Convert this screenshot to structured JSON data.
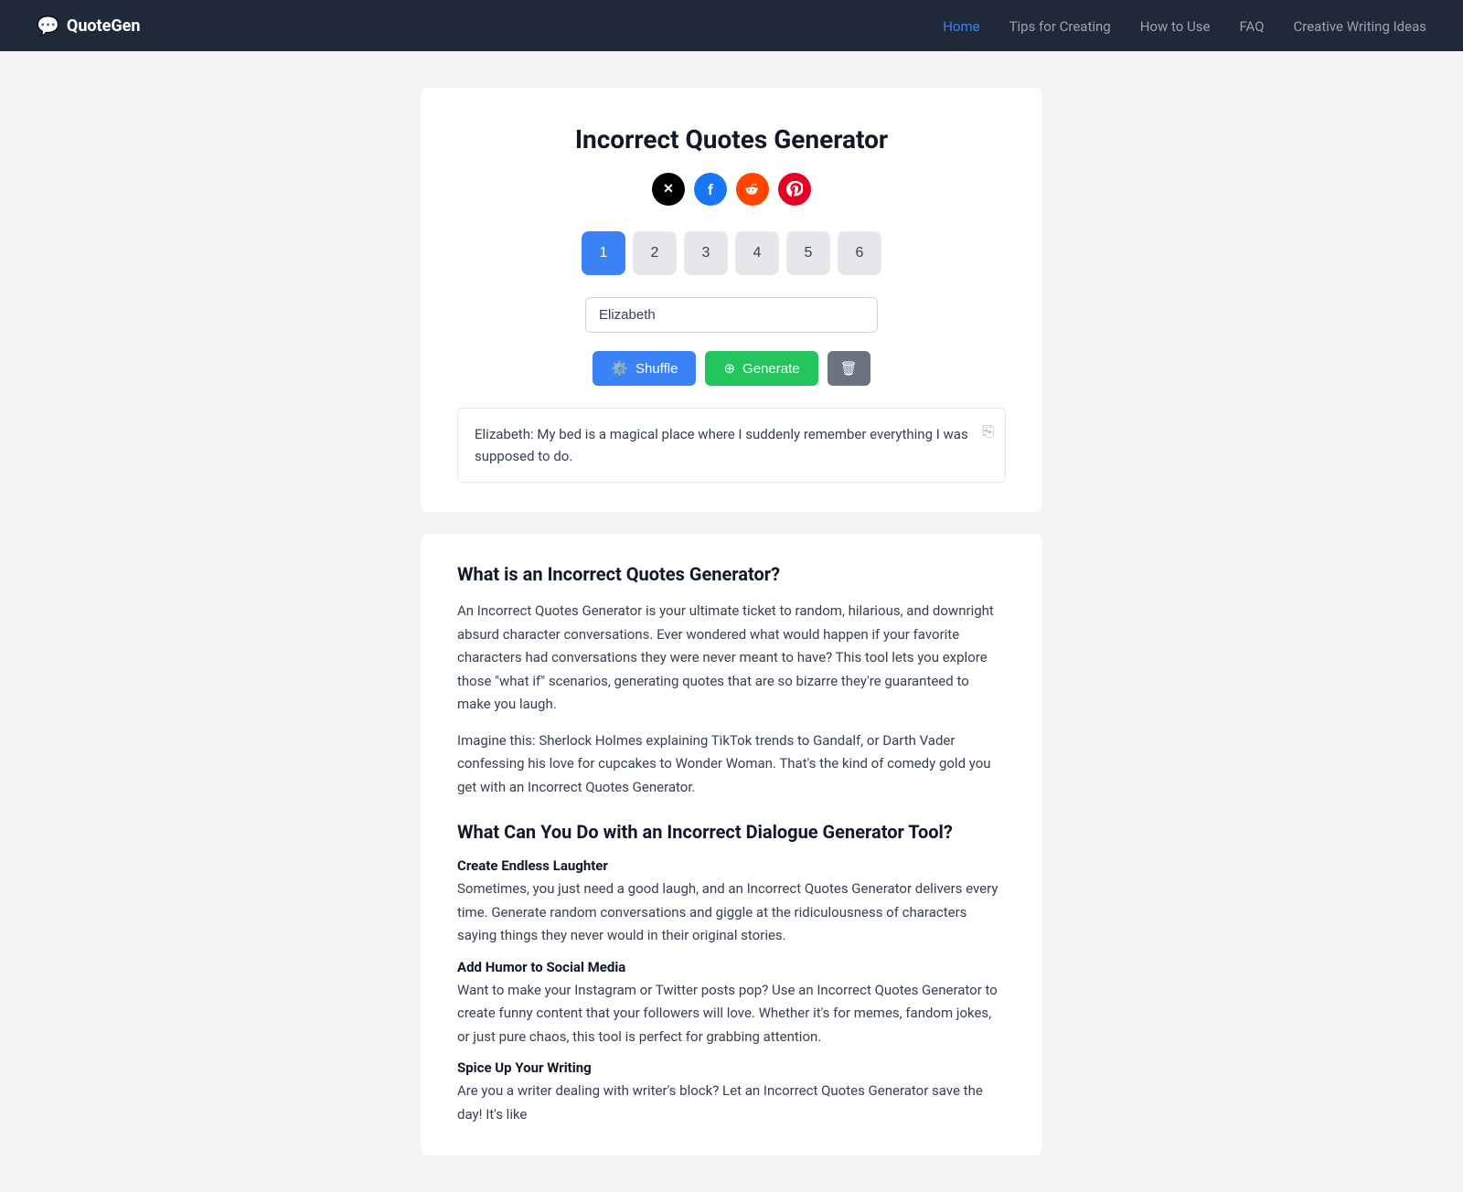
{
  "brand": {
    "name": "QuoteGen",
    "icon": "💬"
  },
  "nav": {
    "links": [
      {
        "label": "Home",
        "active": true
      },
      {
        "label": "Tips for Creating",
        "active": false
      },
      {
        "label": "How to Use",
        "active": false
      },
      {
        "label": "FAQ",
        "active": false
      },
      {
        "label": "Creative Writing Ideas",
        "active": false
      }
    ]
  },
  "generator": {
    "title": "Incorrect Quotes Generator",
    "social_icons": [
      {
        "name": "twitter",
        "symbol": "✕"
      },
      {
        "name": "facebook",
        "symbol": "f"
      },
      {
        "name": "reddit",
        "symbol": "r"
      },
      {
        "name": "pinterest",
        "symbol": "p"
      }
    ],
    "number_tabs": [
      1,
      2,
      3,
      4,
      5,
      6
    ],
    "active_tab": 1,
    "input_placeholder": "Elizabeth",
    "input_value": "Elizabeth",
    "buttons": {
      "shuffle": "Shuffle",
      "generate": "Generate",
      "delete": "🗑"
    },
    "quote": "Elizabeth: My bed is a magical place where I suddenly remember everything I was supposed to do."
  },
  "content": {
    "sections": [
      {
        "heading": "What is an Incorrect Quotes Generator?",
        "paragraphs": [
          "An Incorrect Quotes Generator is your ultimate ticket to random, hilarious, and downright absurd character conversations. Ever wondered what would happen if your favorite characters had conversations they were never meant to have? This tool lets you explore those \"what if\" scenarios, generating quotes that are so bizarre they're guaranteed to make you laugh.",
          "Imagine this: Sherlock Holmes explaining TikTok trends to Gandalf, or Darth Vader confessing his love for cupcakes to Wonder Woman. That's the kind of comedy gold you get with an Incorrect Quotes Generator."
        ]
      },
      {
        "heading": "What Can You Do with an Incorrect Dialogue Generator Tool?",
        "subsections": [
          {
            "title": "Create Endless Laughter",
            "text": "Sometimes, you just need a good laugh, and an Incorrect Quotes Generator delivers every time. Generate random conversations and giggle at the ridiculousness of characters saying things they never would in their original stories."
          },
          {
            "title": "Add Humor to Social Media",
            "text": "Want to make your Instagram or Twitter posts pop? Use an Incorrect Quotes Generator to create funny content that your followers will love. Whether it's for memes, fandom jokes, or just pure chaos, this tool is perfect for grabbing attention."
          },
          {
            "title": "Spice Up Your Writing",
            "text": "Are you a writer dealing with writer's block? Let an Incorrect Quotes Generator save the day! It's like"
          }
        ]
      }
    ]
  }
}
